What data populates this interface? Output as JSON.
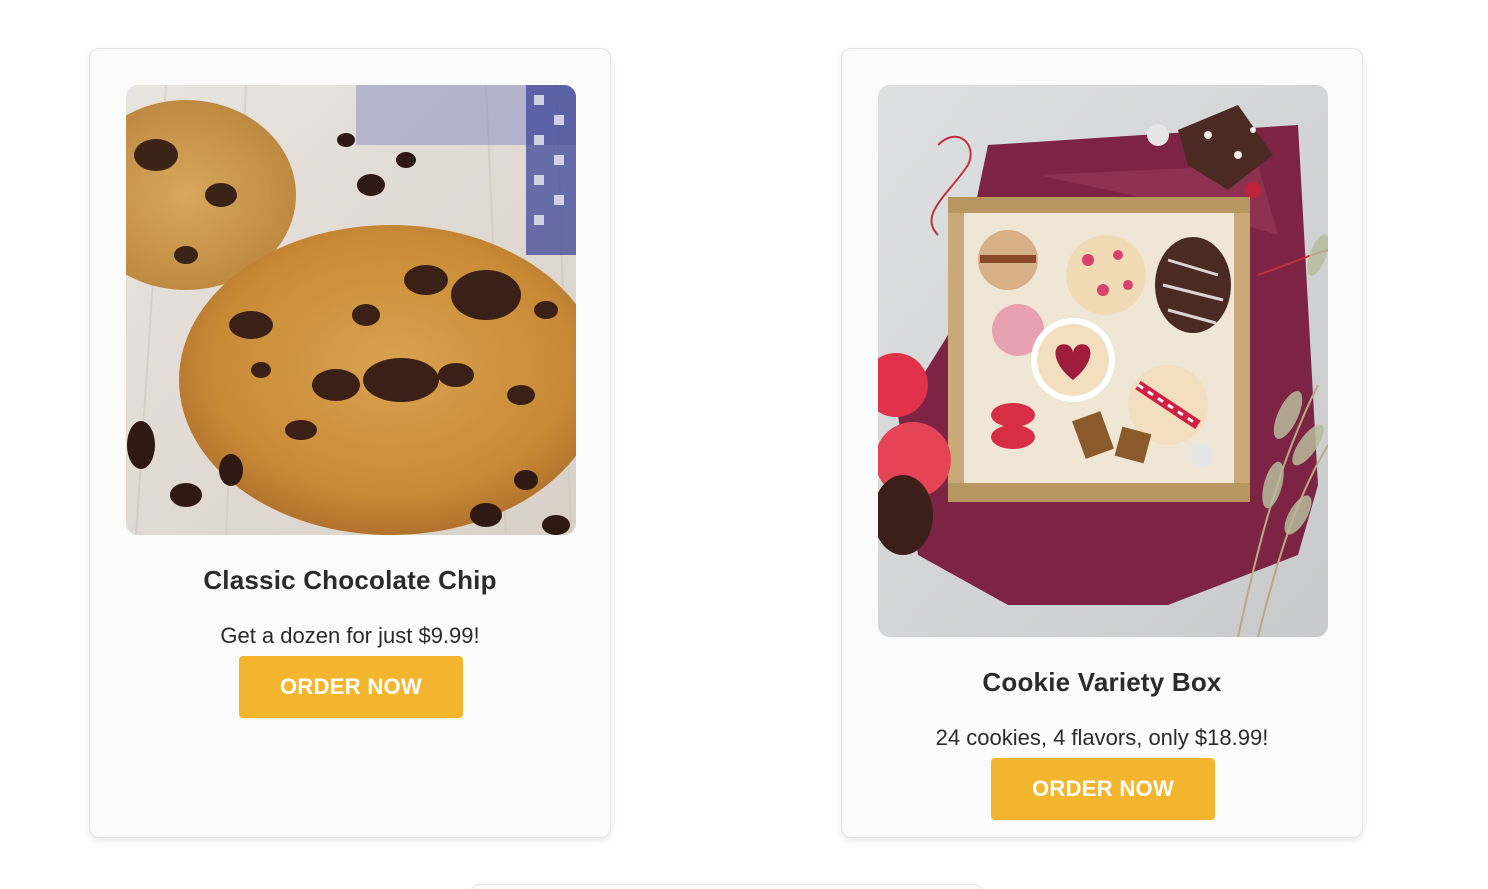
{
  "products": [
    {
      "title": "Classic Chocolate Chip",
      "description": "Get a dozen for just $9.99!",
      "button_label": "ORDER NOW"
    },
    {
      "title": "Cookie Variety Box",
      "description": "24 cookies, 4 flavors, only $18.99!",
      "button_label": "ORDER NOW"
    }
  ],
  "colors": {
    "button_bg": "#f3b52e",
    "button_text": "#ffffff",
    "text": "#2b2b2b",
    "card_bg": "#fbfbfb"
  }
}
